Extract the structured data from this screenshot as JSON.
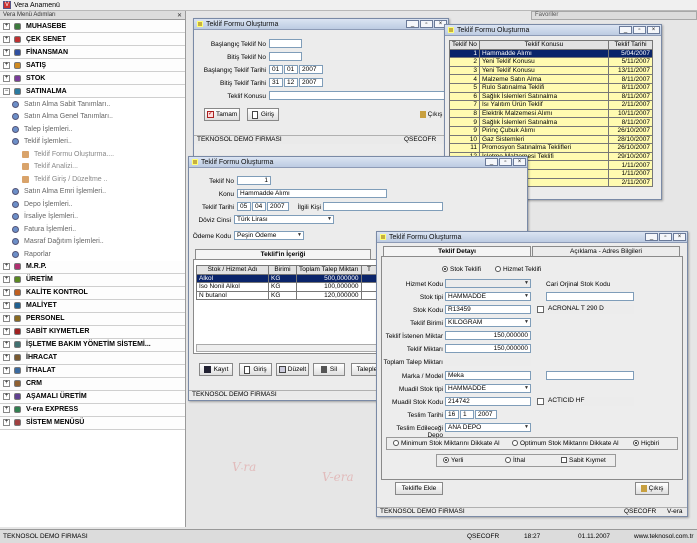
{
  "app": {
    "title": "Vera Anamenü",
    "favorites": "Favoriler"
  },
  "sidebar": {
    "header": "Vera Menü Adımları",
    "groups_top": [
      {
        "label": "MUHASEBE",
        "pm": "+"
      },
      {
        "label": "ÇEK SENET",
        "pm": "+"
      },
      {
        "label": "FİNANSMAN",
        "pm": "+"
      },
      {
        "label": "SATIŞ",
        "pm": "+"
      },
      {
        "label": "STOK",
        "pm": "+"
      },
      {
        "label": "SATINALMA",
        "pm": "-"
      }
    ],
    "subitems": [
      {
        "label": "Satın Alma Sabit Tanımları..",
        "level": 1
      },
      {
        "label": "Satın Alma Genel Tanımları..",
        "level": 1
      },
      {
        "label": "Talep İşlemleri..",
        "level": 1
      },
      {
        "label": "Teklif İşlemleri..",
        "level": 1
      },
      {
        "label": "Teklif Formu Oluşturma....",
        "level": 2
      },
      {
        "label": "Teklif Analizi...",
        "level": 2
      },
      {
        "label": "Teklif Giriş / Düzeltme ..",
        "level": 2
      },
      {
        "label": "Satın Alma Emri İşlemleri..",
        "level": 1
      },
      {
        "label": "Depo İşlemleri..",
        "level": 1
      },
      {
        "label": "İrsaliye İşlemleri..",
        "level": 1
      },
      {
        "label": "Fatura İşlemleri..",
        "level": 1
      },
      {
        "label": "Masraf Dağıtım İşlemleri..",
        "level": 1
      },
      {
        "label": "Raporlar",
        "level": 1
      }
    ],
    "groups_bottom": [
      {
        "label": "M.R.P."
      },
      {
        "label": "ÜRETİM"
      },
      {
        "label": "KALİTE KONTROL"
      },
      {
        "label": "MALİYET"
      },
      {
        "label": "PERSONEL"
      },
      {
        "label": "SABİT KIYMETLER"
      },
      {
        "label": "İŞLETME BAKIM YÖNETİM SİSTEMİ..."
      },
      {
        "label": "İHRACAT"
      },
      {
        "label": "İTHALAT"
      },
      {
        "label": "CRM"
      },
      {
        "label": "AŞAMALI ÜRETİM"
      },
      {
        "label": "V-era EXPRESS"
      },
      {
        "label": "SİSTEM MENÜSÜ"
      }
    ],
    "group_colors": [
      "#3c7a3c",
      "#c03030",
      "#3050a0",
      "#d08a20",
      "#7a3c9a",
      "#2a7aa0",
      "#b03070",
      "#5a8a20",
      "#c06020",
      "#206090",
      "#8a6a20",
      "#a02020",
      "#407070",
      "#7a5a30",
      "#3a6aa0",
      "#906030",
      "#604090",
      "#308050",
      "#a04040"
    ]
  },
  "win1": {
    "title": "Teklif Formu Oluşturma",
    "labels": {
      "bas_no": "Başlangıç Teklif No",
      "bit_no": "Bitiş Teklif No",
      "bas_tarih": "Başlangıç Teklif Tarihi",
      "bit_tarih": "Bitiş Teklif Tarihi",
      "konu": "Teklif Konusu"
    },
    "values": {
      "bas_tarih": [
        "01",
        "01",
        "2007"
      ],
      "bit_tarih": [
        "31",
        "12",
        "2007"
      ]
    },
    "buttons": {
      "tamam": "Tamam",
      "giris": "Giriş",
      "cikis": "Çıkış"
    },
    "status_left": "TEKNOSOL DEMO FIRMASI",
    "status_right": "QSECOFR"
  },
  "win2": {
    "title": "Teklif Formu Oluşturma",
    "columns": [
      "Teklif No",
      "Teklif Konusu",
      "Teklif Tarihi"
    ],
    "rows": [
      [
        "1",
        "Hammadde Alımı",
        "5/04/2007"
      ],
      [
        "2",
        "Yeni Teklif Konusu",
        "5/11/2007"
      ],
      [
        "3",
        "Yeni Teklif Konusu",
        "13/11/2007"
      ],
      [
        "4",
        "Malzeme Satın Alma",
        "8/11/2007"
      ],
      [
        "5",
        "Rulo Satınalma Teklifi",
        "8/11/2007"
      ],
      [
        "6",
        "Sağlık İslemleri Satınalma",
        "8/11/2007"
      ],
      [
        "7",
        "Isı Yalıtım Ürün Teklif",
        "2/11/2007"
      ],
      [
        "8",
        "Elektrik Malzemesi Alımı",
        "10/11/2007"
      ],
      [
        "9",
        "Sağlık İslemleri Satınalma",
        "8/11/2007"
      ],
      [
        "9",
        "Pirinç Çubuk Alımı",
        "26/10/2007"
      ],
      [
        "10",
        "Gaz Sistemleri",
        "28/10/2007"
      ],
      [
        "11",
        "Promosyon Satınalma Teklifleri",
        "26/10/2007"
      ],
      [
        "12",
        "İşletme Malzemesi Teklifi",
        "29/10/2007"
      ],
      [
        "13",
        "Alımı",
        "1/11/2007"
      ],
      [
        "14",
        "Alımı",
        "1/11/2007"
      ],
      [
        "15",
        "",
        "2/11/2007"
      ]
    ]
  },
  "win3": {
    "title": "Teklif Formu Oluşturma",
    "labels": {
      "no": "Teklif No",
      "konu": "Konu",
      "tarih": "Teklif Tarihi",
      "ilgili": "İlgili Kişi",
      "doviz": "Döviz Cinsi",
      "odeme": "Ödeme Kodu"
    },
    "values": {
      "no": "1",
      "konu": "Hammadde Alımı",
      "tarih": [
        "05",
        "04",
        "2007"
      ],
      "doviz": "Türk Lirası",
      "odeme": "Peşin Ödeme"
    },
    "tab": "Teklif'in İçeriği",
    "columns": [
      "Stok / Hizmet Adı",
      "Birimi",
      "Toplam Talep Miktarı",
      "T"
    ],
    "rows": [
      [
        "Alkol",
        "KG",
        "500,000000"
      ],
      [
        "Iso Nonil Alkol",
        "KG",
        "100,000000"
      ],
      [
        "N butanol",
        "KG",
        "120,000000"
      ]
    ],
    "buttons": {
      "kayit": "Kayıt",
      "giris": "Giriş",
      "duzelt": "Düzelt",
      "sil": "Sil",
      "talepler": "Talepler"
    },
    "status_left": "TEKNOSOL DEMO FIRMASI"
  },
  "win4": {
    "title": "Teklif Formu Oluşturma",
    "tabs": [
      "Teklif Detayı",
      "Açıklama - Adres Bilgileri"
    ],
    "radio_type": {
      "stok": "Stok Teklifi",
      "hizmet": "Hizmet Teklifi"
    },
    "labels": {
      "hizmet_kodu": "Hizmet Kodu",
      "stok_tipi": "Stok tipi",
      "stok_kodu": "Stok Kodu",
      "birim": "Teklif Birimi",
      "istenen": "Teklif İstenen Miktar",
      "miktar": "Teklif Miktarı",
      "toplam_talep": "Toplam Talep Miktarı",
      "marka": "Marka / Model",
      "muadil_tip": "Muadil Stok tipi",
      "muadil_kod": "Muadil Stok Kodu",
      "teslim_tarihi": "Teslim Tarihi",
      "teslim_depo": "Teslim Edileceği Depo",
      "cari_kod": "Cari Orjinal Stok Kodu"
    },
    "values": {
      "stok_tipi": "HAMMADDE",
      "stok_kodu": "R13459",
      "stok_adi": "ACRONAL T 290 D",
      "birim": "KILOGRAM",
      "istenen": "150,000000",
      "miktar": "150,000000",
      "marka": "Meka",
      "muadil_tip": "HAMMADDE",
      "muadil_kod": "214742",
      "muadil_adi": "ACTICID HF",
      "teslim_tarihi": [
        "16",
        "1",
        "2007"
      ],
      "teslim_depo": "ANA DEPO"
    },
    "dikkate": {
      "min": "Minimum Stok Miktarını Dikkate Al",
      "opt": "Optimum Stok Miktarını Dikkate Al",
      "hicbiri": "Hiçbiri"
    },
    "origin": {
      "yerli": "Yerli",
      "ithal": "İthal",
      "sabit": "Sabit Kıymet"
    },
    "buttons": {
      "ekle": "Tekliffe Ekle",
      "cikis": "Çıkış"
    },
    "status_left": "TEKNOSOL DEMO FIRMASI",
    "status_mid": "QSECOFR",
    "status_right": "V-era"
  },
  "watermark": "V-era",
  "bottom": {
    "company": "TEKNOSOL DEMO FIRMASI",
    "user": "QSECOFR",
    "time": "18:27",
    "date": "01.11.2007",
    "url": "www.teknosol.com.tr"
  }
}
